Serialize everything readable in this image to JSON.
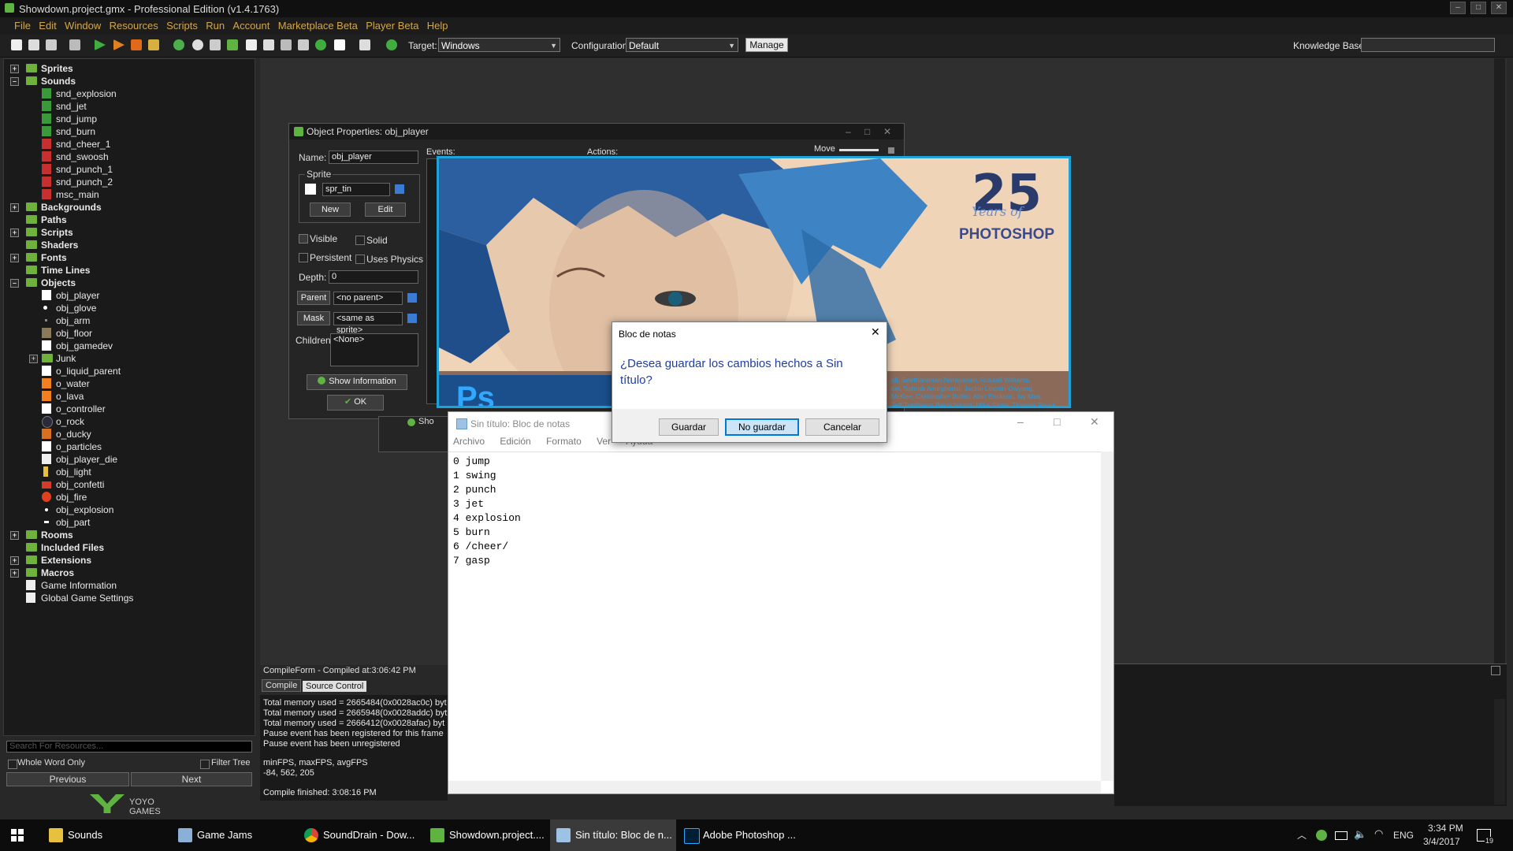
{
  "window": {
    "title": "Showdown.project.gmx  -  Professional Edition (v1.4.1763)"
  },
  "menu": [
    "File",
    "Edit",
    "Window",
    "Resources",
    "Scripts",
    "Run",
    "Account",
    "Marketplace Beta",
    "Player Beta",
    "Help"
  ],
  "toolbar": {
    "target_label": "Target:",
    "target_value": "Windows",
    "config_label": "Configuration:",
    "config_value": "Default",
    "manage": "Manage",
    "kb_label": "Knowledge Base:"
  },
  "tree": {
    "sprites": "Sprites",
    "sounds": "Sounds",
    "sound_items": [
      "snd_explosion",
      "snd_jet",
      "snd_jump",
      "snd_burn",
      "snd_cheer_1",
      "snd_swoosh",
      "snd_punch_1",
      "snd_punch_2",
      "msc_main"
    ],
    "backgrounds": "Backgrounds",
    "paths": "Paths",
    "scripts": "Scripts",
    "shaders": "Shaders",
    "fonts": "Fonts",
    "timelines": "Time Lines",
    "objects": "Objects",
    "object_items": [
      "obj_player",
      "obj_glove",
      "obj_arm",
      "obj_floor",
      "obj_gamedev"
    ],
    "junk": "Junk",
    "object_items2": [
      "o_liquid_parent",
      "o_water",
      "o_lava",
      "o_controller",
      "o_rock",
      "o_ducky",
      "o_particles",
      "obj_player_die",
      "obj_light",
      "obj_confetti",
      "obj_fire",
      "obj_explosion",
      "obj_part"
    ],
    "rooms": "Rooms",
    "included": "Included Files",
    "extensions": "Extensions",
    "macros": "Macros",
    "gameinfo": "Game Information",
    "globalsettings": "Global Game Settings"
  },
  "search": {
    "placeholder": "Search For Resources...",
    "whole_word": "Whole Word Only",
    "filter": "Filter Tree",
    "previous": "Previous",
    "next": "Next"
  },
  "brand": {
    "logo": "YOYO GAMES"
  },
  "objprops": {
    "title": "Object Properties: obj_player",
    "name_label": "Name:",
    "name_value": "obj_player",
    "sprite_group": "Sprite",
    "sprite_value": "spr_tin",
    "new": "New",
    "edit": "Edit",
    "visible": "Visible",
    "solid": "Solid",
    "persistent": "Persistent",
    "uses_physics": "Uses Physics",
    "depth_label": "Depth:",
    "depth_value": "0",
    "parent_btn": "Parent",
    "parent_value": "<no parent>",
    "mask_btn": "Mask",
    "mask_value": "<same as sprite>",
    "children_label": "Children:",
    "children_value": "<None>",
    "show_info": "Show Information",
    "ok": "OK",
    "events": "Events:",
    "actions": "Actions:",
    "move": "Move",
    "hidden_btn": "Sho"
  },
  "photoshop": {
    "num": "25",
    "years": "Years of",
    "brand": "PHOTOSHOP",
    "ps": "Ps",
    "credits1": "oll, Seetharaman Narayanan, Russell Williams,",
    "credits2": "kel, Sohrab Amirghodsi, Jackie Lincoln-Owyang,",
    "credits3": "McKee, Christopher Butler, Alan Erickson, Ivy Mak,",
    "credits4": "Jeff Tranberry, Barry Young, Mike Shaw, Thomas Ruark,"
  },
  "notepad": {
    "title": "Sin título: Bloc de notas",
    "menu": [
      "Archivo",
      "Edición",
      "Formato",
      "Ver",
      "Ayuda"
    ],
    "lines": [
      "0 jump",
      "1 swing",
      "2 punch",
      "3 jet",
      "4 explosion",
      "5 burn",
      "6 /cheer/",
      "7 gasp"
    ]
  },
  "dialog": {
    "title": "Bloc de notas",
    "message_1": "¿Desea guardar los cambios hechos a Sin",
    "message_2": "título?",
    "save": "Guardar",
    "dont_save": "No guardar",
    "cancel": "Cancelar"
  },
  "compile": {
    "header": "CompileForm - Compiled at:3:06:42 PM",
    "tab_compile": "Compile",
    "tab_source": "Source Control",
    "lines": [
      "Total memory used = 2665484(0x0028ac0c) byt",
      "Total memory used = 2665948(0x0028addc) byt",
      "Total memory used = 2666412(0x0028afac) byt",
      "Pause event has been registered for this frame",
      "Pause event has been unregistered"
    ],
    "fps_label": "minFPS, maxFPS, avgFPS",
    "fps_values": "-84, 562, 205",
    "finished": "Compile finished: 3:08:16 PM"
  },
  "taskbar": {
    "items": [
      "Sounds",
      "Game Jams",
      "SoundDrain - Dow...",
      "Showdown.project....",
      "Sin título: Bloc de n...",
      "Adobe Photoshop ..."
    ],
    "lang": "ENG",
    "time": "3:34 PM",
    "date": "3/4/2017",
    "notif": "19"
  },
  "colors": {
    "accent_menu": "#d4a64a",
    "folder_green": "#6fb23a",
    "ps_blue": "#1fa2d8",
    "selected_blue": "#cce4f7"
  }
}
